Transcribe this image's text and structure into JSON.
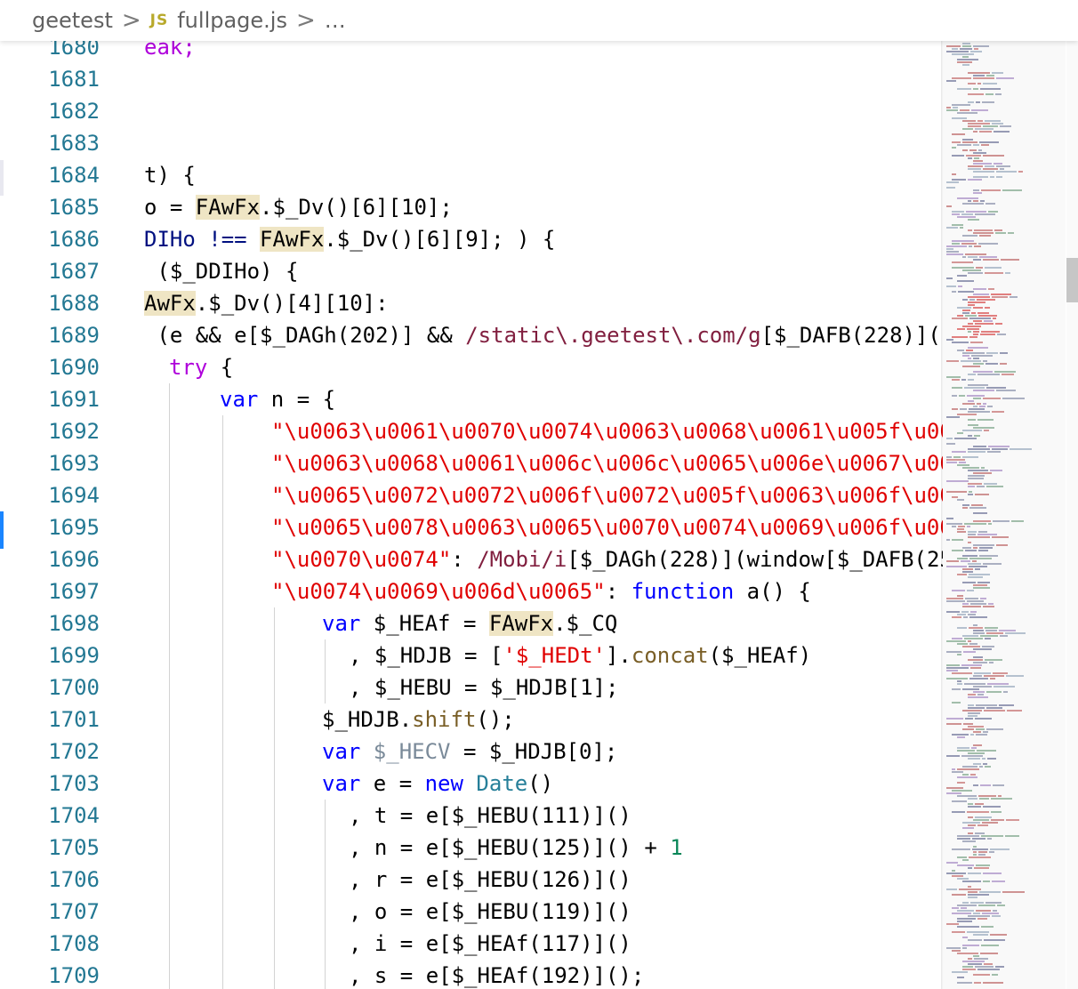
{
  "breadcrumb": {
    "folder": "geetest",
    "separator": ">",
    "file_icon": "JS",
    "file": "fullpage.js",
    "ellipsis": "…"
  },
  "line_numbers": [
    "1680",
    "1681",
    "1682",
    "1683",
    "1684",
    "1685",
    "1686",
    "1687",
    "1688",
    "1689",
    "1690",
    "1691",
    "1692",
    "1693",
    "1694",
    "1695",
    "1696",
    "1697",
    "1698",
    "1699",
    "1700",
    "1701",
    "1702",
    "1703",
    "1704",
    "1705",
    "1706",
    "1707",
    "1708",
    "1709"
  ],
  "code": {
    "l1680": "eak;",
    "l1684_a": "t) {",
    "l1685_a": "o = ",
    "l1685_b": "FAwFx",
    "l1685_c": ".$_Dv()[6][10];",
    "l1686_a": "DIHo !== ",
    "l1686_b": "FAwFx",
    "l1686_c": ".$_Dv()[6][9]; ) {",
    "l1687": " ($_DDIHo) {",
    "l1688_a": "AwFx",
    "l1688_b": ".$_Dv()[4][10]:",
    "l1689_a": " (e && e[$_DAGh(202)] && ",
    "l1689_b": "/static\\.geetest\\.com/g",
    "l1689_c": "[$_DAFB(228)](",
    "l1690": "try",
    "l1690_b": " {",
    "l1691_a": "var",
    "l1691_b": " n = {",
    "l1692": "\"\\u0063\\u0061\\u0070\\u0074\\u0063\\u0068\\u0061\\u005f\\u00",
    "l1693": "\"\\u0063\\u0068\\u0061\\u006c\\u006c\\u0065\\u006e\\u0067\\u00",
    "l1694": "\"\\u0065\\u0072\\u0072\\u006f\\u0072\\u005f\\u0063\\u006f\\u00",
    "l1695": "\"\\u0065\\u0078\\u0063\\u0065\\u0070\\u0074\\u0069\\u006f\\u00",
    "l1696_a": "\"\\u0070\\u0074\"",
    "l1696_b": ": ",
    "l1696_c": "/Mobi/i",
    "l1696_d": "[$_DAGh(228)](window[$_DAFB(25",
    "l1697_a": "\"\\u0074\\u0069\\u006d\\u0065\"",
    "l1697_b": ": ",
    "l1697_c": "function",
    "l1697_d": " a() {",
    "l1698_a": "var",
    "l1698_b": " $_HEAf = ",
    "l1698_c": "FAwFx",
    "l1698_d": ".$_CQ",
    "l1699_a": ", $_HDJB = [",
    "l1699_b": "'$_HEDt'",
    "l1699_c": "].",
    "l1699_d": "concat",
    "l1699_e": "($_HEAf)",
    "l1700": ", $_HEBU = $_HDJB[1];",
    "l1701_a": "$_HDJB.",
    "l1701_b": "shift",
    "l1701_c": "();",
    "l1702_a": "var",
    "l1702_b": " $_HECV",
    "l1702_c": " = $_HDJB[0];",
    "l1703_a": "var",
    "l1703_b": " e = ",
    "l1703_c": "new",
    "l1703_d": " Date",
    "l1703_e": "()",
    "l1704": ", t = e[$_HEBU(111)]()",
    "l1705_a": ", n = e[$_HEBU(125)]() + ",
    "l1705_b": "1",
    "l1706": ", r = e[$_HEBU(126)]()",
    "l1707": ", o = e[$_HEBU(119)]()",
    "l1708": ", i = e[$_HEAf(117)]()",
    "l1709": ", s = e[$_HEAf(192)]();"
  },
  "colors": {
    "keyword": "#0000ff",
    "control": "#af00db",
    "variable": "#001080",
    "function": "#795e26",
    "number": "#098658",
    "string": "#a31515",
    "regex": "#811f3f",
    "line_number": "#237893"
  }
}
